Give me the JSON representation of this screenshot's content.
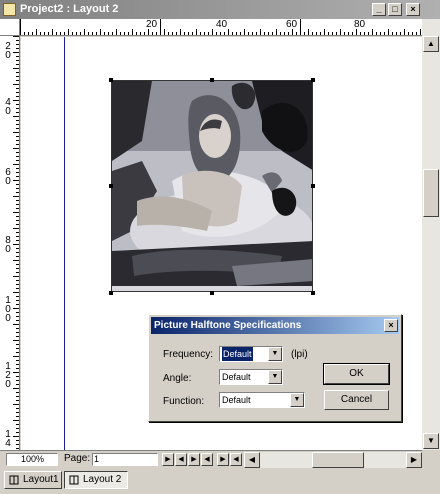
{
  "window": {
    "title": "Project2 : Layout 2",
    "min_glyph": "_",
    "max_glyph": "□",
    "close_glyph": "×"
  },
  "ruler": {
    "h_labels": [
      "20",
      "40",
      "60",
      "80"
    ],
    "v_labels": [
      [
        "2",
        "0"
      ],
      [
        "4",
        "0"
      ],
      [
        "6",
        "0"
      ],
      [
        "8",
        "0"
      ],
      [
        "1",
        "0",
        "0"
      ],
      [
        "1",
        "2",
        "0"
      ],
      [
        "1",
        "4"
      ]
    ]
  },
  "status": {
    "zoom": "100%",
    "page_label": "Page:",
    "page_value": "1",
    "nav": [
      "▶",
      "◀",
      "▶",
      "◀",
      "▶",
      "◀",
      "▶"
    ]
  },
  "tabs": [
    {
      "label": "Layout1"
    },
    {
      "label": "Layout 2"
    }
  ],
  "dialog": {
    "title": "Picture Halftone Specifications",
    "close_glyph": "×",
    "frequency": {
      "label": "Frequency:",
      "value": "Default",
      "unit": "(lpi)"
    },
    "angle": {
      "label": "Angle:",
      "value": "Default"
    },
    "function": {
      "label": "Function:",
      "value": "Default"
    },
    "ok": "OK",
    "cancel": "Cancel"
  },
  "scroll_glyphs": {
    "up": "▲",
    "down": "▼",
    "left": "◀",
    "right": "▶",
    "dropdown": "▼"
  },
  "colors": {
    "dialog_title": "#0a246a",
    "window_title_inactive": "#808080",
    "margin_guide": "#2020a0"
  }
}
